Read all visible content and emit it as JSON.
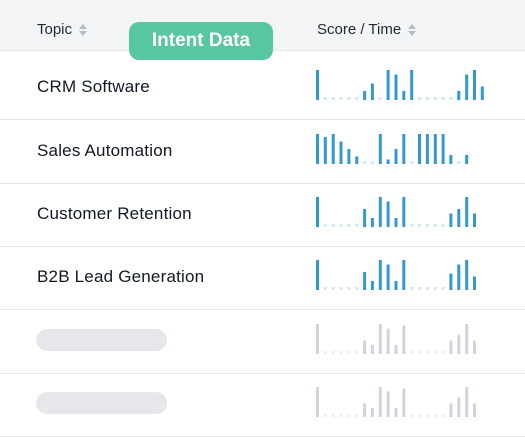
{
  "header": {
    "topic_label": "Topic",
    "score_label": "Score / Time"
  },
  "badge": {
    "label": "Intent Data"
  },
  "colors": {
    "bar": "#3398d2",
    "bar_faint": "#d6e8f4",
    "skeleton_bar": "#d1d5db",
    "skeleton_faint": "#eceef1",
    "badge": "#56c79f"
  },
  "rows": [
    {
      "topic": "CRM Software",
      "bars": [
        1,
        0.1,
        0.1,
        0.1,
        0.1,
        0.1,
        0.3,
        0.55,
        0.1,
        1,
        0.85,
        0.3,
        1,
        0.1,
        0.1,
        0.1,
        0.1,
        0.1,
        0.3,
        0.85,
        1,
        0.45
      ]
    },
    {
      "topic": "Sales Automation",
      "bars": [
        1,
        0.9,
        1,
        0.75,
        0.5,
        0.25,
        0.1,
        0.1,
        1,
        0.15,
        0.5,
        1,
        0.1,
        1,
        1,
        1,
        1,
        0.3,
        0.1,
        0.3
      ]
    },
    {
      "topic": "Customer Retention",
      "bars": [
        1,
        0.1,
        0.1,
        0.1,
        0.1,
        0.1,
        0.6,
        0.3,
        1,
        0.85,
        0.3,
        1,
        0.1,
        0.1,
        0.1,
        0.1,
        0.1,
        0.45,
        0.6,
        1,
        0.45
      ]
    },
    {
      "topic": "B2B Lead Generation",
      "bars": [
        1,
        0.1,
        0.1,
        0.1,
        0.1,
        0.1,
        0.6,
        0.3,
        1,
        0.85,
        0.3,
        1,
        0.1,
        0.1,
        0.1,
        0.1,
        0.1,
        0.55,
        0.85,
        1,
        0.45
      ]
    }
  ],
  "skeleton_rows": [
    {
      "bars": [
        1,
        0.1,
        0.1,
        0.1,
        0.1,
        0.1,
        0.45,
        0.3,
        1,
        0.85,
        0.3,
        0.95,
        0.1,
        0.1,
        0.1,
        0.1,
        0.1,
        0.45,
        0.65,
        1,
        0.45
      ]
    },
    {
      "bars": [
        1,
        0.1,
        0.1,
        0.1,
        0.1,
        0.1,
        0.45,
        0.3,
        1,
        0.85,
        0.3,
        0.95,
        0.1,
        0.1,
        0.1,
        0.1,
        0.1,
        0.45,
        0.65,
        1,
        0.45
      ]
    }
  ]
}
